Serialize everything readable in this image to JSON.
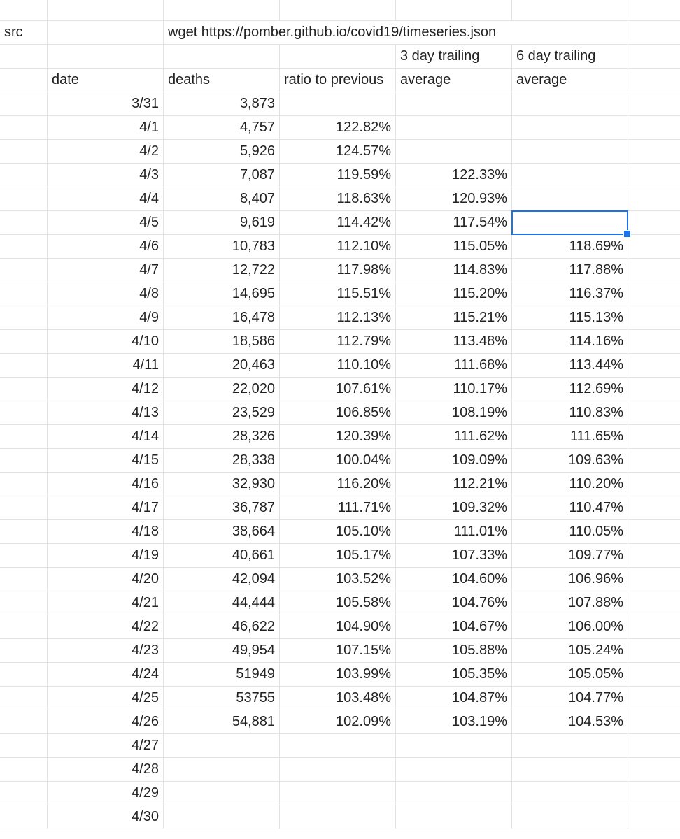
{
  "header_rows": [
    [
      "",
      "",
      "",
      "",
      "",
      ""
    ],
    [
      "src",
      "",
      "wget https://pomber.github.io/covid19/timeseries.json",
      "",
      "",
      ""
    ],
    [
      "",
      "",
      "",
      "",
      "3 day trailing",
      "6 day trailing"
    ],
    [
      "",
      "date",
      "deaths",
      "ratio to previous",
      "average",
      "average"
    ]
  ],
  "data_rows": [
    [
      "3/31",
      "3,873",
      "",
      "",
      ""
    ],
    [
      "4/1",
      "4,757",
      "122.82%",
      "",
      ""
    ],
    [
      "4/2",
      "5,926",
      "124.57%",
      "",
      ""
    ],
    [
      "4/3",
      "7,087",
      "119.59%",
      "122.33%",
      ""
    ],
    [
      "4/4",
      "8,407",
      "118.63%",
      "120.93%",
      ""
    ],
    [
      "4/5",
      "9,619",
      "114.42%",
      "117.54%",
      ""
    ],
    [
      "4/6",
      "10,783",
      "112.10%",
      "115.05%",
      "118.69%"
    ],
    [
      "4/7",
      "12,722",
      "117.98%",
      "114.83%",
      "117.88%"
    ],
    [
      "4/8",
      "14,695",
      "115.51%",
      "115.20%",
      "116.37%"
    ],
    [
      "4/9",
      "16,478",
      "112.13%",
      "115.21%",
      "115.13%"
    ],
    [
      "4/10",
      "18,586",
      "112.79%",
      "113.48%",
      "114.16%"
    ],
    [
      "4/11",
      "20,463",
      "110.10%",
      "111.68%",
      "113.44%"
    ],
    [
      "4/12",
      "22,020",
      "107.61%",
      "110.17%",
      "112.69%"
    ],
    [
      "4/13",
      "23,529",
      "106.85%",
      "108.19%",
      "110.83%"
    ],
    [
      "4/14",
      "28,326",
      "120.39%",
      "111.62%",
      "111.65%"
    ],
    [
      "4/15",
      "28,338",
      "100.04%",
      "109.09%",
      "109.63%"
    ],
    [
      "4/16",
      "32,930",
      "116.20%",
      "112.21%",
      "110.20%"
    ],
    [
      "4/17",
      "36,787",
      "111.71%",
      "109.32%",
      "110.47%"
    ],
    [
      "4/18",
      "38,664",
      "105.10%",
      "111.01%",
      "110.05%"
    ],
    [
      "4/19",
      "40,661",
      "105.17%",
      "107.33%",
      "109.77%"
    ],
    [
      "4/20",
      "42,094",
      "103.52%",
      "104.60%",
      "106.96%"
    ],
    [
      "4/21",
      "44,444",
      "105.58%",
      "104.76%",
      "107.88%"
    ],
    [
      "4/22",
      "46,622",
      "104.90%",
      "104.67%",
      "106.00%"
    ],
    [
      "4/23",
      "49,954",
      "107.15%",
      "105.88%",
      "105.24%"
    ],
    [
      "4/24",
      "51949",
      "103.99%",
      "105.35%",
      "105.05%"
    ],
    [
      "4/25",
      "53755",
      "103.48%",
      "104.87%",
      "104.77%"
    ],
    [
      "4/26",
      "54,881",
      "102.09%",
      "103.19%",
      "104.53%"
    ],
    [
      "4/27",
      "",
      "",
      "",
      ""
    ],
    [
      "4/28",
      "",
      "",
      "",
      ""
    ],
    [
      "4/29",
      "",
      "",
      "",
      ""
    ],
    [
      "4/30",
      "",
      "",
      "",
      ""
    ]
  ],
  "selected_cell": {
    "data_row": 5,
    "column": "6 day trailing average"
  }
}
